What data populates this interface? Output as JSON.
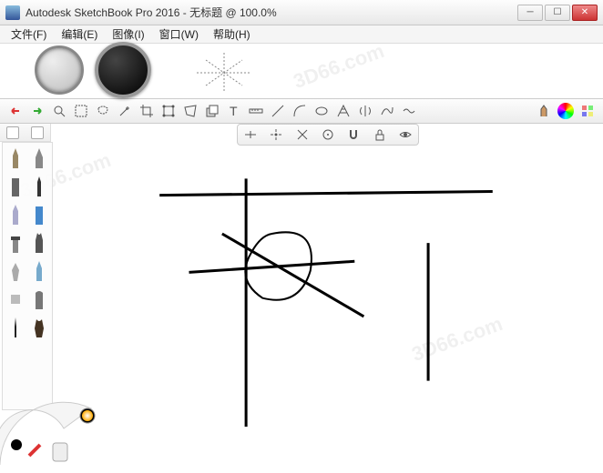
{
  "title": "Autodesk SketchBook Pro 2016 - 无标题 @ 100.0%",
  "menu": {
    "file": "文件(F)",
    "edit": "编辑(E)",
    "image": "图像(I)",
    "window": "窗口(W)",
    "help": "帮助(H)"
  },
  "zoom": "100.0%",
  "document": "无标题",
  "watermark": "3D66.com",
  "toolbar_icons": [
    "undo",
    "redo",
    "zoom",
    "marquee",
    "lasso",
    "magic-wand",
    "crop",
    "transform",
    "distort",
    "layer",
    "text",
    "ruler",
    "line",
    "curve",
    "ellipse",
    "perspective",
    "symmetry",
    "french-curve",
    "steady-stroke",
    "brush",
    "color",
    "grid"
  ],
  "subtoolbar_icons": [
    "snap-h",
    "snap-center",
    "snap-45",
    "snap-radial",
    "magnet",
    "lock",
    "eye"
  ],
  "brushes": [
    "pencil",
    "airbrush",
    "marker",
    "pen",
    "ballpoint",
    "chisel",
    "flat",
    "paintbrush",
    "smear",
    "eraser-hard",
    "eraser-soft",
    "blend",
    "ink",
    "wash"
  ]
}
